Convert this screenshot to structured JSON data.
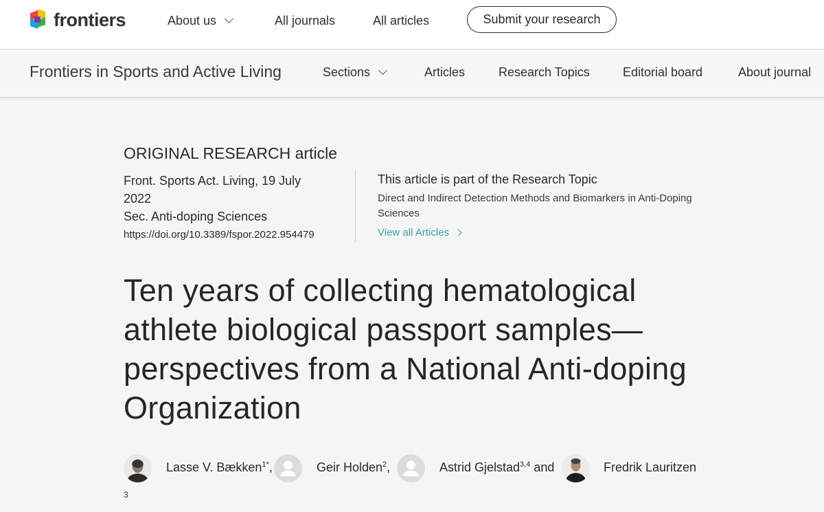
{
  "header": {
    "logo_text": "frontiers",
    "nav": {
      "about_us": "About us",
      "all_journals": "All journals",
      "all_articles": "All articles"
    },
    "submit_label": "Submit your research"
  },
  "journal_bar": {
    "title": "Frontiers in Sports and Active Living",
    "nav": {
      "sections": "Sections",
      "articles": "Articles",
      "research_topics": "Research Topics",
      "editorial_board": "Editorial board",
      "about_journal": "About journal"
    }
  },
  "article": {
    "type": "ORIGINAL RESEARCH article",
    "citation_line1": "Front. Sports Act. Living, 19 July",
    "citation_line2": "2022",
    "section": "Sec. Anti-doping Sciences",
    "doi": "https://doi.org/10.3389/fspor.2022.954479",
    "research_topic": {
      "heading": "This article is part of the Research Topic",
      "name": "Direct and Indirect Detection Methods and Biomarkers in Anti-Doping Sciences",
      "view_all": "View all Articles"
    },
    "title": "Ten years of collecting hematological athlete biological passport samples—perspectives from a National Anti-doping Organization",
    "authors": [
      {
        "name": "Lasse V. Bækken",
        "affil": "1*",
        "sep": ","
      },
      {
        "name": "Geir Holden",
        "affil": "2",
        "sep": ","
      },
      {
        "name": "Astrid Gjelstad",
        "affil": "3,4",
        "sep": " and"
      },
      {
        "name": "Fredrik Lauritzen",
        "affil": "",
        "sep": ""
      }
    ],
    "trailing_affil": "3"
  },
  "colors": {
    "accent_teal": "#3aa3a3",
    "background": "#f5f5f5",
    "header_bg": "#ffffff"
  }
}
